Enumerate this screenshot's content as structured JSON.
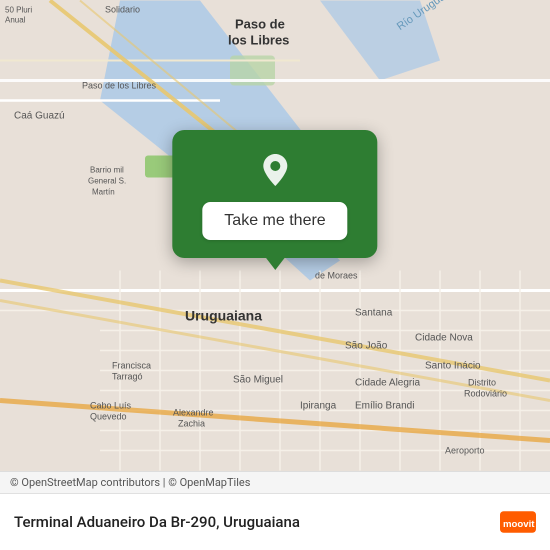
{
  "map": {
    "attribution": "© OpenStreetMap contributors | © OpenMapTiles",
    "background_color": "#e8e0d8"
  },
  "popup": {
    "button_label": "Take me there",
    "pin_color": "#ffffff"
  },
  "bottom_bar": {
    "location_name": "Terminal Aduaneiro Da Br-290, Uruguaiana"
  },
  "moovit": {
    "brand_color": "#ff5c00"
  }
}
